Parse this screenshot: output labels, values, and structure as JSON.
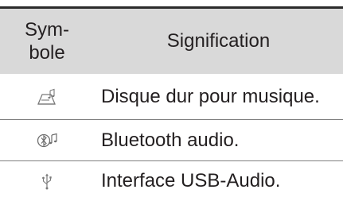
{
  "header": {
    "symbol_line1": "Sym-",
    "symbol_line2": "bole",
    "meaning": "Signification"
  },
  "rows": [
    {
      "icon": "hard-disk-music-icon",
      "text": "Disque dur pour musique."
    },
    {
      "icon": "bluetooth-audio-icon",
      "text": "Bluetooth audio."
    },
    {
      "icon": "usb-icon",
      "text": "Interface USB-Audio."
    }
  ]
}
